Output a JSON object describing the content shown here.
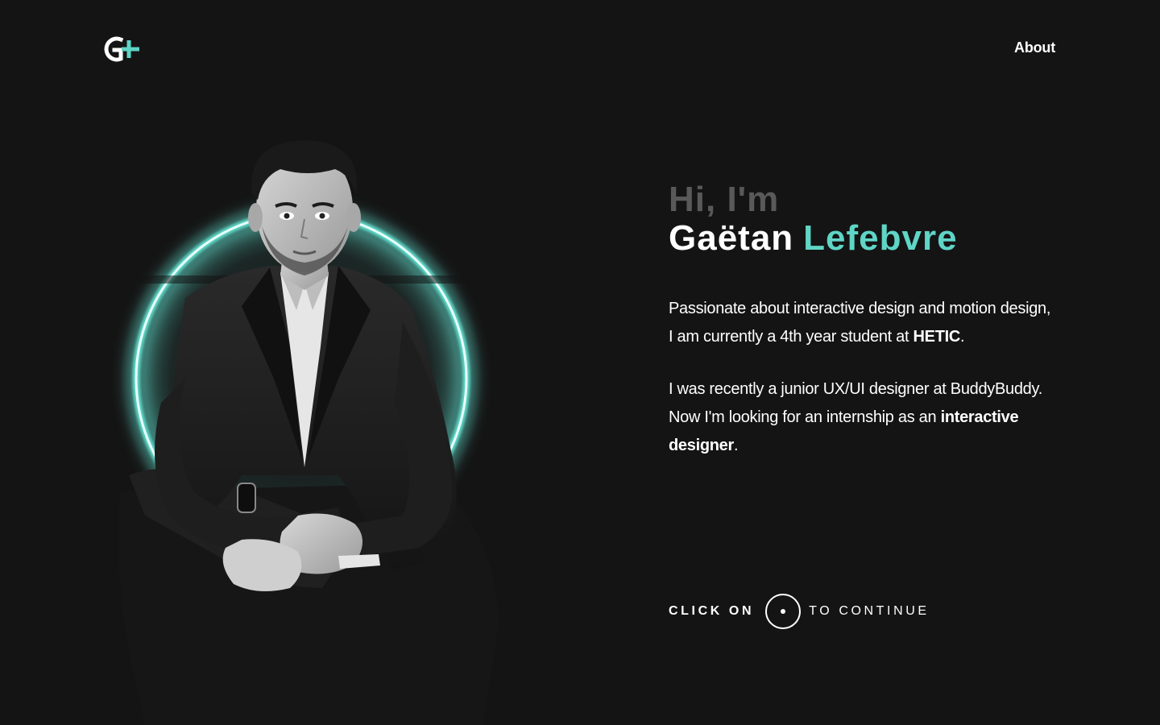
{
  "header": {
    "nav_about_label": "About"
  },
  "intro": {
    "greeting": "Hi, I'm",
    "first_name": "Gaëtan",
    "last_name": "Lefebvre",
    "para1_text": "Passionate about interactive design and motion design, I am currently a 4th year student at ",
    "para1_strong": "HETIC",
    "para1_end": ".",
    "para2_text": "I was recently a junior UX/UI designer at BuddyBuddy. Now I'm looking for an internship as an ",
    "para2_strong": "interactive designer",
    "para2_end": "."
  },
  "cta": {
    "left_label": "CLICK ON",
    "right_label": "TO CONTINUE"
  },
  "colors": {
    "background": "#141414",
    "accent": "#5fd5c6",
    "greeting": "#595959",
    "text": "#ffffff"
  },
  "icons": {
    "logo": "g-plus-logo-icon",
    "cta": "circle-dot-icon"
  }
}
